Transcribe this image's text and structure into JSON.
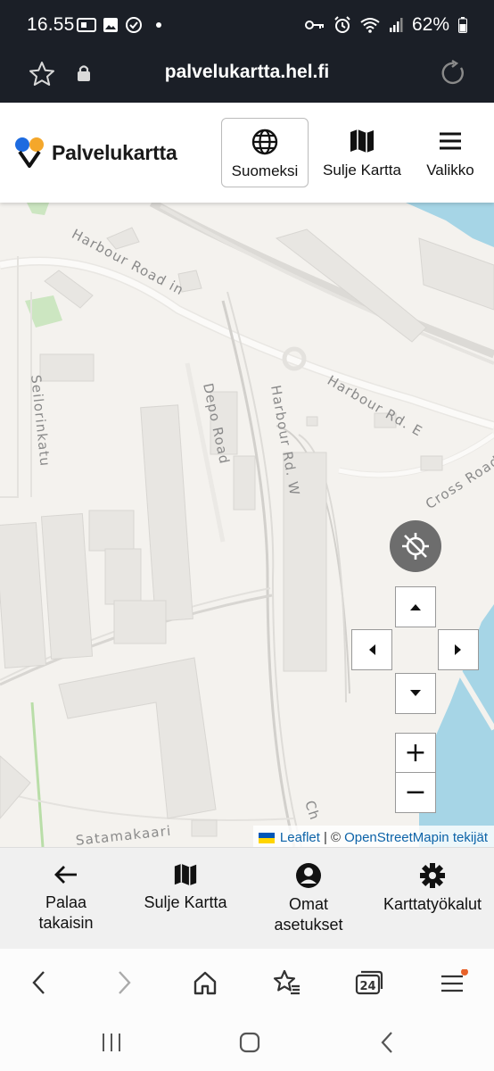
{
  "status_bar": {
    "time": "16.55",
    "battery": "62%"
  },
  "browser": {
    "url": "palvelukartta.hel.fi",
    "tab_count": "24"
  },
  "header": {
    "app_name": "Palvelukartta",
    "language_label": "Suomeksi",
    "close_map_label": "Sulje Kartta",
    "menu_label": "Valikko"
  },
  "map": {
    "street_labels": {
      "harbour_road_in": "Harbour Road in",
      "seilorinkatu": "Seilorinkatu",
      "depo_road": "Depo Road",
      "harbour_rd_w": "Harbour Rd. W",
      "harbour_rd_e": "Harbour Rd. E",
      "cross_road": "Cross Road",
      "satamakaari": "Satamakaari",
      "ch": "Ch"
    },
    "zoom_in_label": "+",
    "zoom_out_label": "−",
    "attribution": {
      "leaflet": "Leaflet",
      "separator": "| ©",
      "osm": "OpenStreetMapin tekijät"
    },
    "colors": {
      "water": "#a6d5e6",
      "background": "#f4f2ee",
      "building": "#e8e6e2",
      "park": "#cce6c1"
    }
  },
  "bottom_nav": {
    "back": "Palaa takaisin",
    "close_map": "Sulje Kartta",
    "settings": "Omat asetukset",
    "tools": "Karttatyökalut"
  },
  "colors": {
    "dark_bar": "#1b1f27",
    "logo_blue": "#1d6be0",
    "logo_orange": "#f4a72b",
    "notification_dot": "#e8622a"
  }
}
